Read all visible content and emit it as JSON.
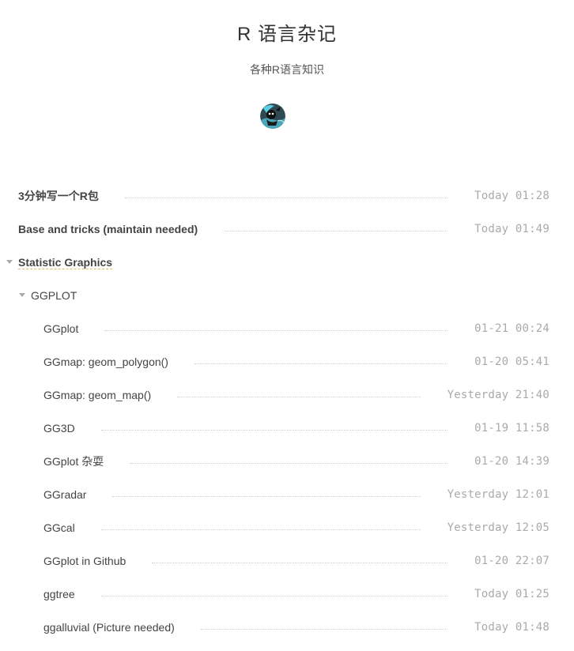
{
  "site": {
    "title": "R 语言杂记",
    "subtitle": "各种R语言知识"
  },
  "avatar": {
    "icon": "avatar-image"
  },
  "posts": [
    {
      "title": "3分钟写一个R包",
      "date": "Today 01:28"
    },
    {
      "title": "Base and tricks (maintain needed)",
      "date": "Today 01:49"
    }
  ],
  "category": {
    "title": "Statistic Graphics",
    "subcategory": {
      "title": "GGPLOT",
      "items": [
        {
          "title": "GGplot",
          "date": "01-21 00:24"
        },
        {
          "title": "GGmap: geom_polygon()",
          "date": "01-20 05:41"
        },
        {
          "title": "GGmap: geom_map()",
          "date": "Yesterday 21:40"
        },
        {
          "title": "GG3D",
          "date": "01-19 11:58"
        },
        {
          "title": "GGplot 杂耍",
          "date": "01-20 14:39"
        },
        {
          "title": "GGradar",
          "date": "Yesterday 12:01"
        },
        {
          "title": "GGcal",
          "date": "Yesterday 12:05"
        },
        {
          "title": "GGplot in Github",
          "date": "01-20 22:07"
        },
        {
          "title": "ggtree",
          "date": "Today 01:25"
        },
        {
          "title": "ggalluvial (Picture needed)",
          "date": "Today 01:48"
        }
      ]
    }
  },
  "colors": {
    "text": "#333333",
    "date": "#aaaaaa",
    "category_underline": "#e6b86a"
  }
}
